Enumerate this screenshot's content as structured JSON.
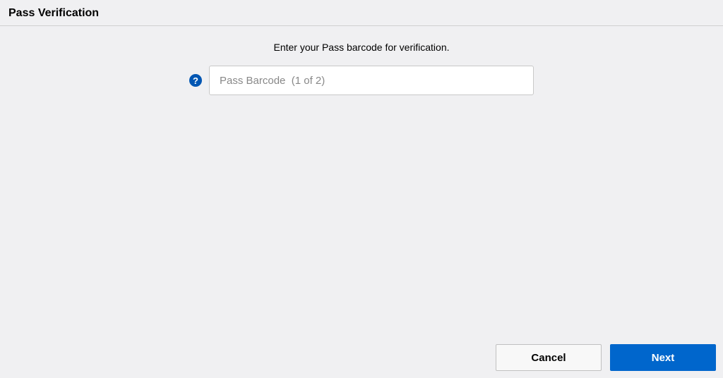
{
  "header": {
    "title": "Pass Verification"
  },
  "content": {
    "instruction": "Enter your Pass barcode for verification.",
    "help_icon_label": "?",
    "barcode_placeholder": "Pass Barcode  (1 of 2)"
  },
  "footer": {
    "cancel_label": "Cancel",
    "next_label": "Next"
  }
}
